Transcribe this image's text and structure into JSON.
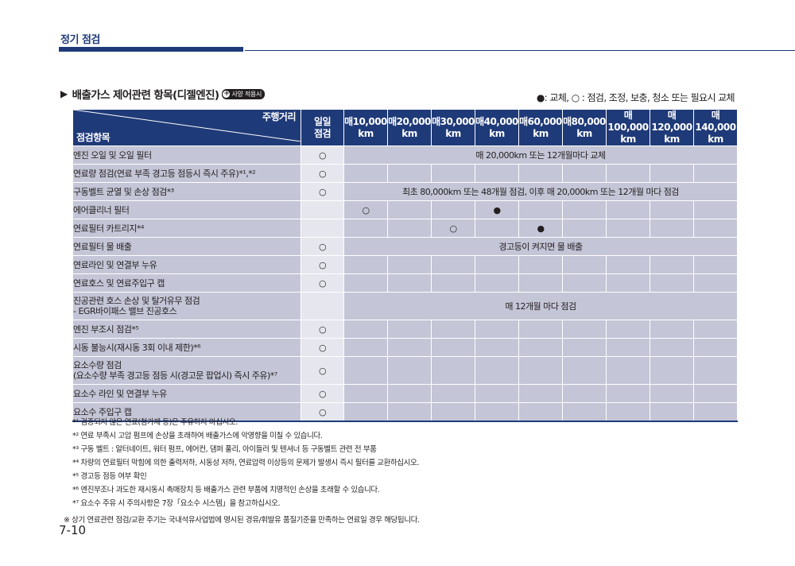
{
  "header": {
    "section_title": "정기 점검"
  },
  "heading": {
    "arrow": "▶",
    "title": "배출가스 제어관련 항목(디젤엔진)",
    "badge_plus": "+",
    "badge_label": "사양 적용시"
  },
  "legend": "●: 교체, ○ : 점검, 조정, 보충, 청소 또는 필요시 교체",
  "table": {
    "header": {
      "distance_label": "주행거리",
      "item_label": "점검항목",
      "daily_line1": "일일",
      "daily_line2": "점검",
      "intervals": [
        {
          "top": "매10,000",
          "unit": "km"
        },
        {
          "top": "매20,000",
          "unit": "km"
        },
        {
          "top": "매30,000",
          "unit": "km"
        },
        {
          "top": "매40,000",
          "unit": "km"
        },
        {
          "top": "매60,000",
          "unit": "km"
        },
        {
          "top": "매80,000",
          "unit": "km"
        },
        {
          "top": "매100,000",
          "unit": "km"
        },
        {
          "top": "매120,000",
          "unit": "km"
        },
        {
          "top": "매140,000",
          "unit": "km"
        }
      ]
    },
    "rows": [
      {
        "item": "엔진 오일 및 오일 필터",
        "item2": "",
        "daily": "○",
        "span": "매 20,000km 또는 12개월마다 교체",
        "cells": []
      },
      {
        "item": "연료량 점검(연료 부족 경고등 점등시 즉시 주유)*¹,*²",
        "item2": "",
        "daily": "○",
        "span": "",
        "cells": [
          "",
          "",
          "",
          "",
          "",
          "",
          "",
          "",
          ""
        ]
      },
      {
        "item": "구동벨트 균열 및 손상 점검*³",
        "item2": "",
        "daily": "○",
        "span": "최초 80,000km 또는 48개월 점검, 이후 매 20,000km 또는 12개월 마다 점검",
        "cells": []
      },
      {
        "item": "에어클리너 필터",
        "item2": "",
        "daily": "",
        "span": "",
        "cells": [
          "○",
          "",
          "",
          "●",
          "",
          "",
          "",
          "",
          ""
        ]
      },
      {
        "item": "연료필터 카트리지*⁴",
        "item2": "",
        "daily": "",
        "span": "",
        "cells": [
          "",
          "",
          "○",
          "",
          "●",
          "",
          "",
          "",
          ""
        ]
      },
      {
        "item": "연료필터 물 배출",
        "item2": "",
        "daily": "○",
        "span": "경고등이 켜지면 물 배출",
        "cells": []
      },
      {
        "item": "연료라인 및 연결부 누유",
        "item2": "",
        "daily": "○",
        "span": "",
        "cells": [
          "",
          "",
          "",
          "",
          "",
          "",
          "",
          "",
          ""
        ]
      },
      {
        "item": "연료호스 및 연료주입구 캡",
        "item2": "",
        "daily": "○",
        "span": "",
        "cells": [
          "",
          "",
          "",
          "",
          "",
          "",
          "",
          "",
          ""
        ]
      },
      {
        "item": "진공관련 호스 손상 및 탈거유무 점검",
        "item2": "- EGR바이패스 밸브 진공호스",
        "daily": "",
        "span": "매 12개월 마다 점검",
        "cells": []
      },
      {
        "item": "엔진 부조시 점검*⁵",
        "item2": "",
        "daily": "○",
        "span": "",
        "cells": [
          "",
          "",
          "",
          "",
          "",
          "",
          "",
          "",
          ""
        ]
      },
      {
        "item": "시동 불능시(재시동 3회 이내 제한)*⁶",
        "item2": "",
        "daily": "○",
        "span": "",
        "cells": [
          "",
          "",
          "",
          "",
          "",
          "",
          "",
          "",
          ""
        ]
      },
      {
        "item": "요소수량 점검",
        "item2": "(요소수량 부족 경고등 점등 시(경고문 팝업시) 즉시 주유)*⁷",
        "daily": "○",
        "span": "",
        "cells": [
          "",
          "",
          "",
          "",
          "",
          "",
          "",
          "",
          ""
        ]
      },
      {
        "item": "요소수 라인 및 연결부 누유",
        "item2": "",
        "daily": "○",
        "span": "",
        "cells": [
          "",
          "",
          "",
          "",
          "",
          "",
          "",
          "",
          ""
        ]
      },
      {
        "item": "요소수 주입구 캡",
        "item2": "",
        "daily": "○",
        "span": "",
        "cells": [
          "",
          "",
          "",
          "",
          "",
          "",
          "",
          "",
          ""
        ]
      }
    ]
  },
  "notes": [
    {
      "mark": "*¹",
      "text": "검증되지 않은 연료(첨가제 등)은 주유하지 마십시오."
    },
    {
      "mark": "*²",
      "text": "연료 부족시 고압 펌프에 손상을 초래하여 배출가스에 악영향을 미칠 수 있습니다."
    },
    {
      "mark": "*³",
      "text": "구동 벨트 : 알터네이트, 워터 펌프, 에어컨, 댐퍼 풀리, 아이들러 및 텐셔너 등 구동벨트 관련 전 부품"
    },
    {
      "mark": "*⁴",
      "text": "차량의 연료필터 막힘에 의한 출력저하, 시동성 저하, 연료압력 이상등의 문제가 발생시 즉시 필터를 교환하십시오."
    },
    {
      "mark": "*⁵",
      "text": "경고등 점등 여부 확인"
    },
    {
      "mark": "*⁶",
      "text": "엔진부조나 과도한 재시동시 촉매장치 등 배출가스 관련 부품에 치명적인 손상을 초래할 수 있습니다."
    },
    {
      "mark": "*⁷",
      "text": "요소수 주유 시 주의사항은 7장「요소수 시스템」을 참고하십시오."
    }
  ],
  "footnote": "※ 상기 연료관련 점검/교환 주기는 국내석유사업법에 명시된 경유/휘발유 품질기준을 만족하는 연료일 경우 해당됩니다.",
  "page_number": "7-10",
  "colors": {
    "header_navy": "#1f3a78",
    "row_gray": "#c4c5d6",
    "daily_light": "#e6e7ee"
  }
}
